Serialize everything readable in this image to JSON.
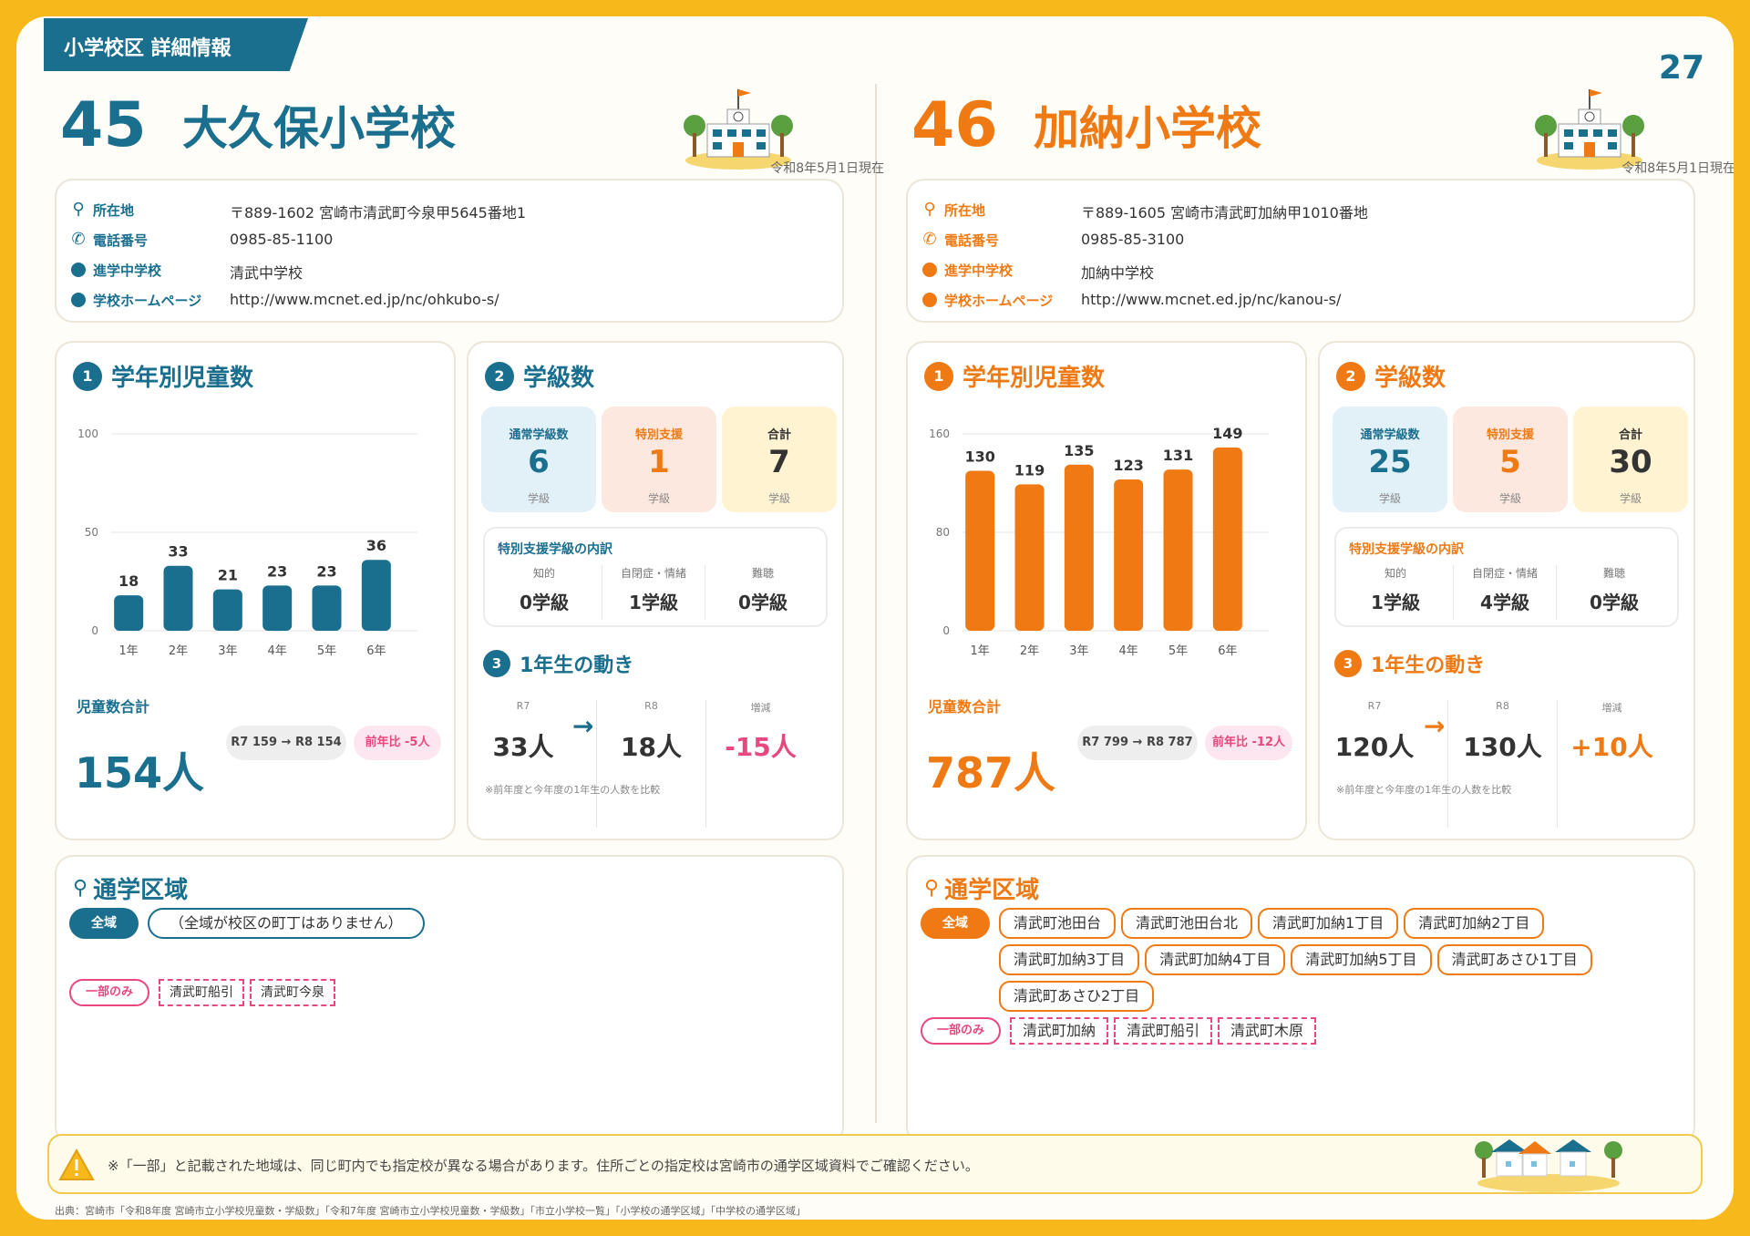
{
  "header": {
    "section_label": "小学校区 詳細情報",
    "page_number": "27"
  },
  "colors": {
    "teal": "#1a6e8e",
    "orange": "#ef7a14",
    "pink": "#e8487c",
    "frame": "#f7b81c"
  },
  "info_labels": {
    "address": "所在地",
    "phone": "電話番号",
    "middle_school": "進学中学校",
    "homepage": "学校ホームページ"
  },
  "section_labels": {
    "grade_title": "学年別児童数",
    "class_title": "学級数",
    "move_title": "1年生の動き",
    "area_title": "通学区域",
    "total_label": "児童数合計",
    "regular": "通常学級数",
    "special": "特別支援",
    "total": "合計",
    "unit": "学級",
    "breakdown_title": "特別支援学級の内訳",
    "b_intellectual": "知的",
    "b_autism": "自閉症・情緒",
    "b_hearing": "難聴",
    "r7": "R7",
    "r8": "R8",
    "change": "増減",
    "move_note": "※前年度と今年度の1年生の人数を比較",
    "all_tag": "全域",
    "part_tag": "一部のみ",
    "arrow": "→"
  },
  "schools": [
    {
      "number": "45",
      "name": "大久保小学校",
      "as_of": "令和8年5月1日現在",
      "address": "〒889-1602 宮崎市清武町今泉甲5645番地1",
      "phone": "0985-85-1100",
      "middle_school": "清武中学校",
      "homepage": "http://www.mcnet.ed.jp/nc/ohkubo-s/",
      "total_students": "154人",
      "comparison": "R7 159 → R8 154",
      "yoy": "前年比 -5人",
      "classes": {
        "regular": "6",
        "special": "1",
        "total": "7"
      },
      "breakdown": {
        "intellectual": "0学級",
        "autism": "1学級",
        "hearing": "0学級"
      },
      "first_grade": {
        "r7": "33人",
        "r8": "18人",
        "change": "-15人"
      },
      "area_all": [
        "（全域が校区の町丁はありません）"
      ],
      "area_part": [
        "清武町船引",
        "清武町今泉"
      ]
    },
    {
      "number": "46",
      "name": "加納小学校",
      "as_of": "令和8年5月1日現在",
      "address": "〒889-1605 宮崎市清武町加納甲1010番地",
      "phone": "0985-85-3100",
      "middle_school": "加納中学校",
      "homepage": "http://www.mcnet.ed.jp/nc/kanou-s/",
      "total_students": "787人",
      "comparison": "R7 799 → R8 787",
      "yoy": "前年比 -12人",
      "classes": {
        "regular": "25",
        "special": "5",
        "total": "30"
      },
      "breakdown": {
        "intellectual": "1学級",
        "autism": "4学級",
        "hearing": "0学級"
      },
      "first_grade": {
        "r7": "120人",
        "r8": "130人",
        "change": "+10人"
      },
      "area_all": [
        "清武町池田台",
        "清武町池田台北",
        "清武町加納1丁目",
        "清武町加納2丁目",
        "清武町加納3丁目",
        "清武町加納4丁目",
        "清武町加納5丁目",
        "清武町あさひ1丁目",
        "清武町あさひ2丁目"
      ],
      "area_part": [
        "清武町加納",
        "清武町船引",
        "清武町木原"
      ]
    }
  ],
  "chart_data": [
    {
      "type": "bar",
      "categories": [
        "1年",
        "2年",
        "3年",
        "4年",
        "5年",
        "6年"
      ],
      "values": [
        18,
        33,
        21,
        23,
        23,
        36
      ],
      "ylim": [
        0,
        100
      ],
      "yticks": [
        "0",
        "50",
        "100"
      ],
      "grid": true,
      "color": "#1a6e8e"
    },
    {
      "type": "bar",
      "categories": [
        "1年",
        "2年",
        "3年",
        "4年",
        "5年",
        "6年"
      ],
      "values": [
        130,
        119,
        135,
        123,
        131,
        149
      ],
      "ylim": [
        0,
        160
      ],
      "yticks": [
        "0",
        "80",
        "160"
      ],
      "grid": true,
      "color": "#ef7a14"
    }
  ],
  "footer": {
    "notice": "※「一部」と記載された地域は、同じ町内でも指定校が異なる場合があります。住所ごとの指定校は宮崎市の通学区域資料でご確認ください。",
    "source": "出典：宮崎市「令和8年度 宮崎市立小学校児童数・学級数」「令和7年度 宮崎市立小学校児童数・学級数」「市立小学校一覧」「小学校の通学区域」「中学校の通学区域」"
  }
}
